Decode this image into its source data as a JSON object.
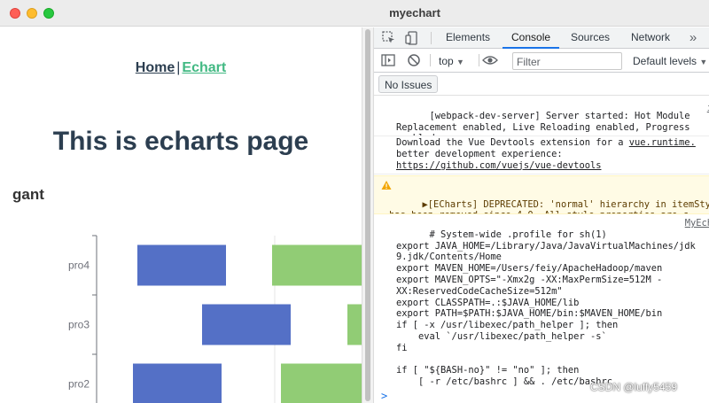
{
  "window": {
    "title": "myechart"
  },
  "page": {
    "nav": {
      "home": "Home",
      "separator": "|",
      "echart": "Echart"
    },
    "heading": "This is echarts page",
    "chart_title": "gant"
  },
  "chart_data": {
    "type": "bar",
    "title": "gant",
    "categories": [
      "pro4",
      "pro3",
      "pro2"
    ],
    "series": [
      {
        "color": "#5470c6",
        "segments": [
          [
            155,
            255
          ],
          [
            228,
            328
          ],
          [
            150,
            250
          ]
        ]
      },
      {
        "color": "#91cc75",
        "segments": [
          [
            307,
            420
          ],
          [
            392,
            420
          ],
          [
            317,
            420
          ]
        ]
      }
    ],
    "colors": {
      "blue": "#5470c6",
      "green": "#91cc75"
    }
  },
  "devtools": {
    "tabs": [
      "Elements",
      "Console",
      "Sources",
      "Network"
    ],
    "active_tab": "Console",
    "more_icon": "chevron-double-right-icon",
    "context": "top",
    "filter_placeholder": "Filter",
    "levels": "Default levels",
    "issues_button": "No Issues",
    "messages": [
      {
        "text": "[webpack-dev-server] Server started: Hot Module\nReplacement enabled, Live Reloading enabled, Progress\nenabled.",
        "source": "i"
      },
      {
        "text_before": "Download the Vue Devtools extension for a ",
        "link1": "vue.runtime.",
        "text_mid": "\nbetter development experience:\n",
        "link2": "https://github.com/vuejs/vue-devtools"
      },
      {
        "text": "▶[ECharts] DEPRECATED: 'normal' hierarchy in itemStyl\nhas been removed since 4.0. All style properties are c\nitemStyle directly now.",
        "level": "warning"
      },
      {
        "text": "# System-wide .profile for sh(1)\nexport JAVA_HOME=/Library/Java/JavaVirtualMachines/jdk\n9.jdk/Contents/Home\nexport MAVEN_HOME=/Users/feiy/ApacheHadoop/maven\nexport MAVEN_OPTS=\"-Xmx2g -XX:MaxPermSize=512M -\nXX:ReservedCodeCacheSize=512m\"\nexport CLASSPATH=.:$JAVA_HOME/lib\nexport PATH=$PATH:$JAVA_HOME/bin:$MAVEN_HOME/bin\nif [ -x /usr/libexec/path_helper ]; then\n    eval `/usr/libexec/path_helper -s`\nfi\n\nif [ \"${BASH-no}\" != \"no\" ]; then\n    [ -r /etc/bashrc ] && . /etc/bashrc\nfi",
        "source": "MyEch"
      }
    ],
    "prompt": ">"
  },
  "watermark": "CSDN @luffy5459"
}
